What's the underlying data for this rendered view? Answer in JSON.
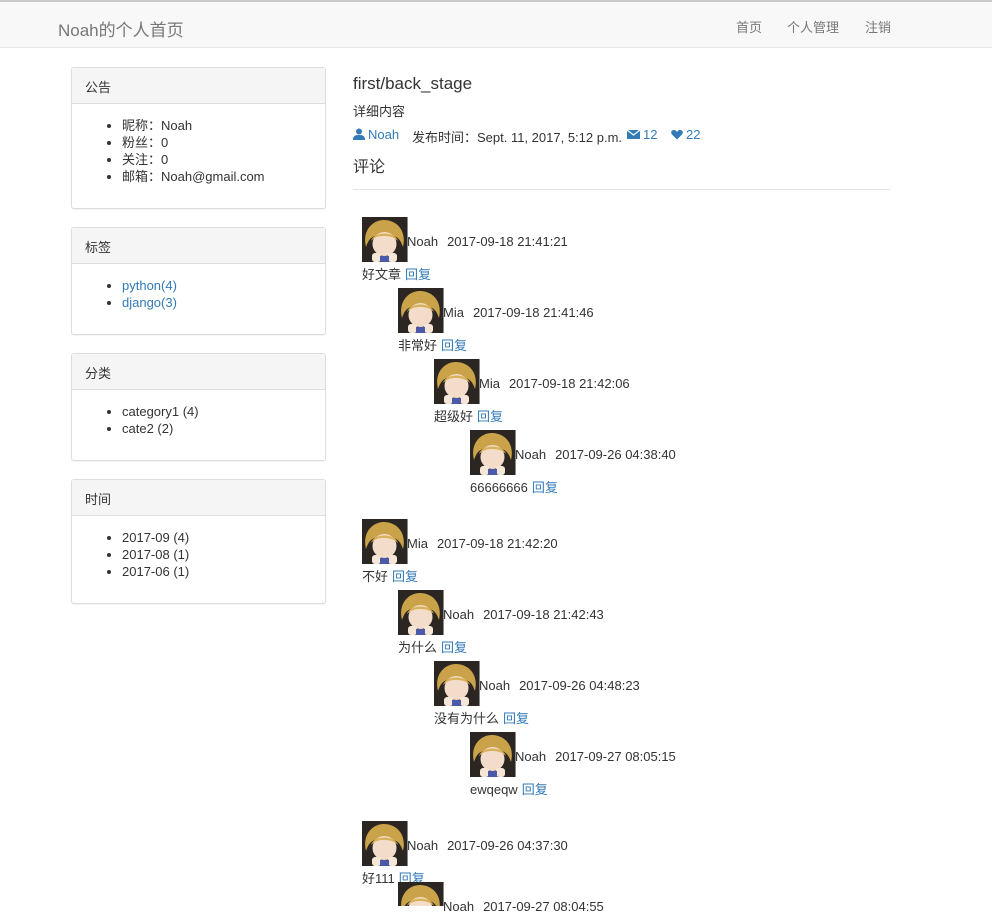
{
  "navbar": {
    "brand": "Noah的个人首页",
    "links": [
      "首页",
      "个人管理",
      "注销"
    ]
  },
  "sidebar": {
    "announcement": {
      "title": "公告",
      "items": [
        "昵称：Noah",
        "粉丝：0",
        "关注：0",
        "邮箱：Noah@gmail.com"
      ]
    },
    "tags": {
      "title": "标签",
      "items": [
        "python(4)",
        "django(3)"
      ]
    },
    "categories": {
      "title": "分类",
      "items": [
        "category1 (4)",
        "cate2 (2)"
      ]
    },
    "archive": {
      "title": "时间",
      "items": [
        "2017-09 (4)",
        "2017-08 (1)",
        "2017-06 (1)"
      ]
    }
  },
  "article": {
    "title": "first/back_stage",
    "detail": "详细内容",
    "author": "Noah",
    "published_label": "发布时间：Sept. 11, 2017, 5:12 p.m.",
    "comment_count": "12",
    "like_count": "22",
    "comments_heading": "评论"
  },
  "reply_label": "回复",
  "comments": [
    {
      "user": "Noah",
      "time": "2017-09-18 21:41:21",
      "text": "好文章"
    },
    {
      "user": "Mia",
      "time": "2017-09-18 21:41:46",
      "text": "非常好"
    },
    {
      "user": "Mia",
      "time": "2017-09-18 21:42:06",
      "text": "超级好"
    },
    {
      "user": "Noah",
      "time": "2017-09-26 04:38:40",
      "text": "66666666"
    },
    {
      "user": "Mia",
      "time": "2017-09-18 21:42:20",
      "text": "不好"
    },
    {
      "user": "Noah",
      "time": "2017-09-18 21:42:43",
      "text": "为什么"
    },
    {
      "user": "Noah",
      "time": "2017-09-26 04:48:23",
      "text": "没有为什么"
    },
    {
      "user": "Noah",
      "time": "2017-09-27 08:05:15",
      "text": "ewqeqw"
    },
    {
      "user": "Noah",
      "time": "2017-09-26 04:37:30",
      "text": "好111"
    },
    {
      "user": "Noah",
      "time": "2017-09-27 08:04:55",
      "text": ""
    }
  ],
  "colors": {
    "link": "#337ab7",
    "navbar_bg": "#f8f8f8",
    "panel_heading_bg": "#f5f5f5",
    "text": "#333333"
  }
}
